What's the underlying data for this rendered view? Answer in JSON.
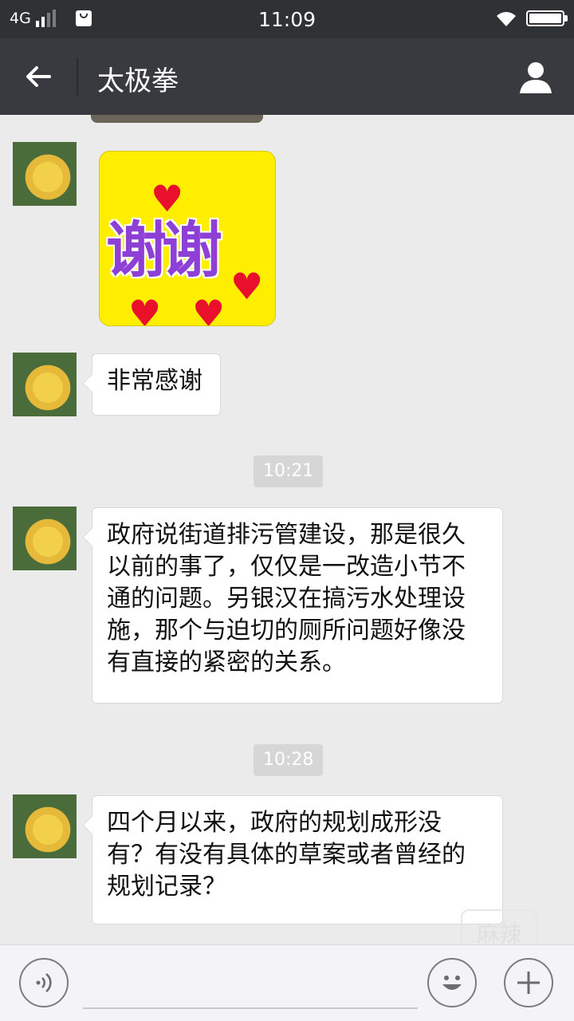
{
  "status_bar": {
    "network": "4G",
    "time": "11:09",
    "icons": [
      "signal-icon",
      "shopping-bag-icon",
      "wifi-icon",
      "battery-icon"
    ]
  },
  "title_bar": {
    "title": "太极拳",
    "back_icon": "arrow-left-icon",
    "profile_icon": "person-icon"
  },
  "messages": [
    {
      "type": "sticker",
      "text": "谢谢"
    },
    {
      "type": "text",
      "text": "非常感谢"
    },
    {
      "type": "timestamp",
      "text": "10:21"
    },
    {
      "type": "text",
      "lines": [
        "政府说街道排污管建设，那是很久",
        "以前的事了，仅仅是一改造小节不",
        "通的问题。另银汉在搞污水处理设",
        "施，那个与迫切的厕所问题好像没",
        "有直接的紧密的关系。"
      ]
    },
    {
      "type": "timestamp",
      "text": "10:28"
    },
    {
      "type": "text",
      "lines": [
        "四个月以来，政府的规划成形没",
        "有？有没有具体的草案或者曾经的",
        "规划记录？"
      ]
    }
  ],
  "input_bar": {
    "voice_icon": "voice-icon",
    "emoji_icon": "emoji-icon",
    "plus_icon": "plus-icon"
  },
  "colors": {
    "status_bg": "#2f3235",
    "titlebar_bg": "#393a3f",
    "chat_bg": "#ebebeb",
    "sticker_bg": "#ffee00",
    "sticker_text": "#8e3fd6",
    "heart": "#e8102a"
  }
}
